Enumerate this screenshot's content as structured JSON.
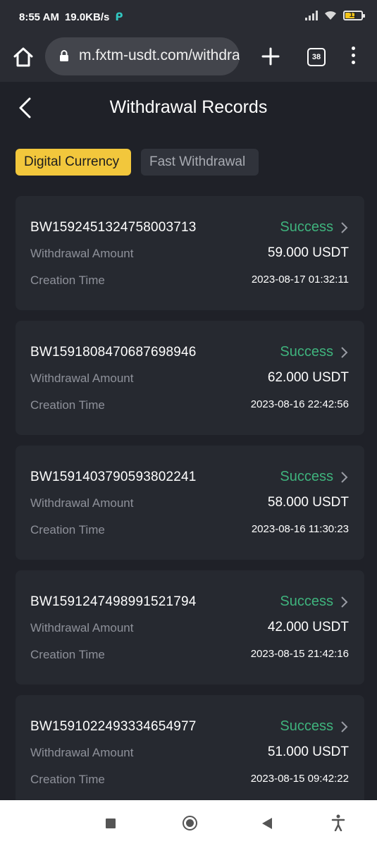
{
  "status_bar": {
    "time": "8:55 AM",
    "speed": "19.0KB/s",
    "battery": "11"
  },
  "browser": {
    "url": "m.fxtm-usdt.com/withdraw",
    "tab_count": "38"
  },
  "header": {
    "title": "Withdrawal Records"
  },
  "tabs": [
    {
      "label": "Digital Currency",
      "active": true
    },
    {
      "label": "Fast Withdrawal",
      "active": false
    }
  ],
  "labels": {
    "amount": "Withdrawal Amount",
    "time": "Creation Time"
  },
  "records": [
    {
      "id": "BW1592451324758003713",
      "status": "Success",
      "amount": "59.000 USDT",
      "time": "2023-08-17 01:32:11"
    },
    {
      "id": "BW1591808470687698946",
      "status": "Success",
      "amount": "62.000 USDT",
      "time": "2023-08-16 22:42:56"
    },
    {
      "id": "BW1591403790593802241",
      "status": "Success",
      "amount": "58.000 USDT",
      "time": "2023-08-16 11:30:23"
    },
    {
      "id": "BW1591247498991521794",
      "status": "Success",
      "amount": "42.000 USDT",
      "time": "2023-08-15 21:42:16"
    },
    {
      "id": "BW1591022493334654977",
      "status": "Success",
      "amount": "51.000 USDT",
      "time": "2023-08-15 09:42:22"
    }
  ],
  "colors": {
    "accent": "#f2c73c",
    "success": "#3fb37d",
    "background": "#1f2128",
    "card": "#262930"
  }
}
